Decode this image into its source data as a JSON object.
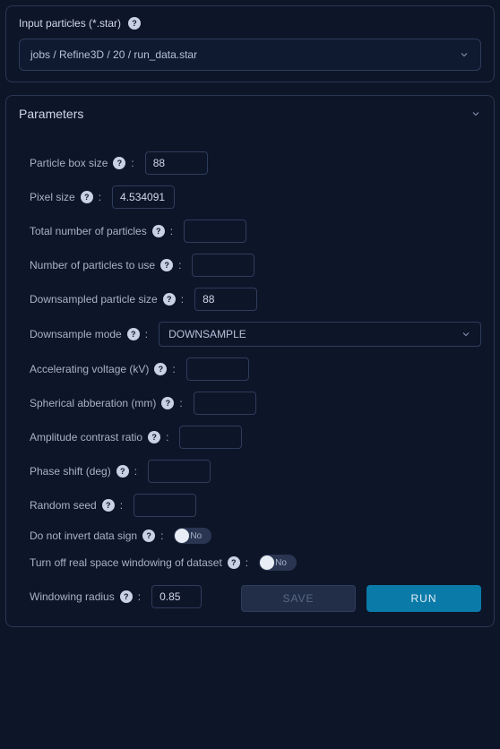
{
  "input_section": {
    "label": "Input particles (*.star)",
    "selected_path": "jobs / Refine3D / 20 / run_data.star"
  },
  "parameters": {
    "title": "Parameters",
    "fields": {
      "particle_box_size": {
        "label": "Particle box size",
        "value": "88"
      },
      "pixel_size": {
        "label": "Pixel size",
        "value": "4.534091"
      },
      "total_particles": {
        "label": "Total number of particles",
        "value": ""
      },
      "num_to_use": {
        "label": "Number of particles to use",
        "value": ""
      },
      "downsampled_size": {
        "label": "Downsampled particle size",
        "value": "88"
      },
      "downsample_mode": {
        "label": "Downsample mode",
        "value": "DOWNSAMPLE"
      },
      "accel_voltage": {
        "label": "Accelerating voltage (kV)",
        "value": ""
      },
      "spherical_ab": {
        "label": "Spherical abberation (mm)",
        "value": ""
      },
      "amp_contrast": {
        "label": "Amplitude contrast ratio",
        "value": ""
      },
      "phase_shift": {
        "label": "Phase shift (deg)",
        "value": ""
      },
      "random_seed": {
        "label": "Random seed",
        "value": ""
      },
      "no_invert_sign": {
        "label": "Do not invert data sign",
        "value": "No"
      },
      "turn_off_window": {
        "label": "Turn off real space windowing of dataset",
        "value": "No"
      },
      "windowing_radius": {
        "label": "Windowing radius",
        "value": "0.85"
      }
    },
    "buttons": {
      "save": "SAVE",
      "run": "RUN"
    }
  }
}
